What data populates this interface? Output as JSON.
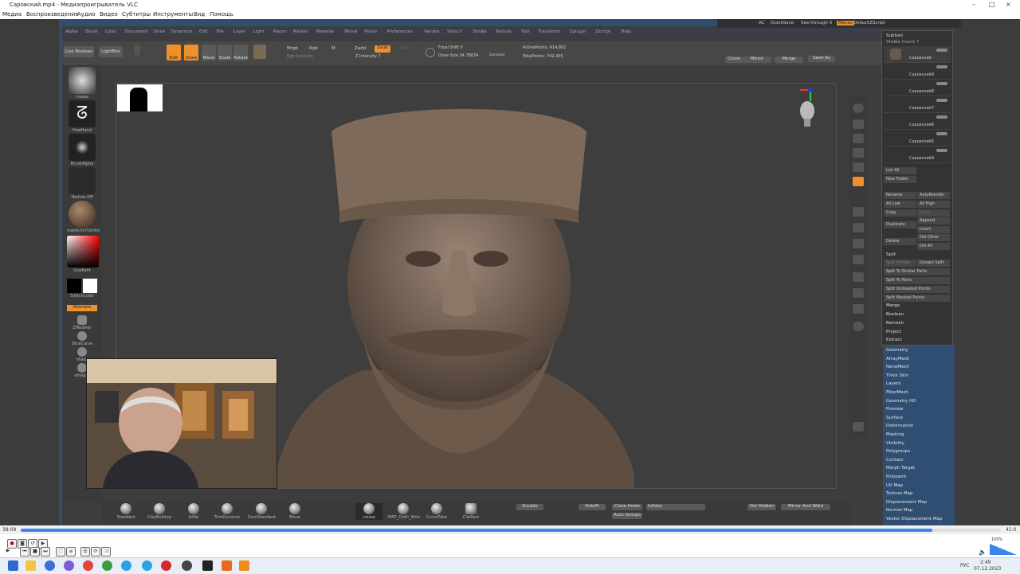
{
  "window": {
    "title": "Саровский.mp4 - Медиапроигрыватель VLC",
    "controls": [
      "–",
      "□",
      "×"
    ]
  },
  "menu": [
    "Медиа",
    "Воспроизведение",
    "Аудио",
    "Видео",
    "Субтитры",
    "Инструменты",
    "Вид",
    "Помощь"
  ],
  "zbrush": {
    "menu": [
      "Alpha",
      "Brush",
      "Color",
      "Document",
      "Draw",
      "Dynamics",
      "Edit",
      "File",
      "Layer",
      "Light",
      "Macro",
      "Marker",
      "Material",
      "Movie",
      "Picker",
      "Preferences",
      "Render",
      "Stencil",
      "Stroke",
      "Texture",
      "Tool",
      "Transform",
      "Zplugin",
      "Zscript",
      "Help"
    ],
    "top_right": [
      "AC",
      "QuickSave",
      "See-through 0",
      "Menus",
      "DefaultZScript"
    ],
    "toolbar": {
      "live_boolean": "Live Boolean",
      "lightbox": "LightBox",
      "edit": "Edit",
      "draw": "Draw",
      "move": "Move",
      "scale": "Scale",
      "rotate": "Rotate",
      "mrgb": "Mrgb",
      "rgb": "Rgb",
      "m": "M",
      "rgb_intensity": "Rgb Intensity",
      "zadd": "Zadd",
      "zsub": "Zsub",
      "zcut": "Zcut",
      "z_intensity": "Z Intensity 7",
      "focal_shift": "Focal Shift 0",
      "draw_size": "Draw Size 34.78834",
      "dynamic": "Dynamic",
      "active_points": "ActivePoints: 414,801",
      "total_points": "TotalPoints: 742,405",
      "clone": "Clone",
      "mirror": "Mirror",
      "merge": "Merge",
      "save_as": "Save As"
    },
    "left_shelf": [
      "crease",
      "FreeHand",
      "BrushAlpha",
      "Texture Off",
      "matAcrimTurntst",
      "Gradient",
      "SwitchColor",
      "Alternate",
      "ZModeler",
      "SliceCurve",
      "sharp",
      "straight"
    ],
    "bottom_shelf": [
      "Standard",
      "ClayBuildup",
      "Inflat",
      "TrimDynamic",
      "DamStandard",
      "Move",
      "crease",
      "XMD_Cloth_Wrin",
      "CurveTube",
      "ClipRect"
    ],
    "bottom_right": {
      "double": "Double",
      "hide_pt": "HidePt",
      "close_holes": "Close Holes",
      "auto_groups": "Auto Groups",
      "inflate": "Inflate",
      "del_hidden": "Del Hidden",
      "mirror_weld": "Mirror And Weld"
    },
    "subtool": {
      "title": "Subtool",
      "visible_count": "Visible Count 7",
      "items": [
        "Саровский",
        "Саровский9",
        "Саровский8",
        "Саровский7",
        "Саровский6",
        "Саровский5",
        "Саровский4"
      ],
      "buttons": [
        "List All",
        "New Folder",
        "Rename",
        "AutoReorder",
        "All Low",
        "All High",
        "Copy",
        "Paste",
        "Duplicate",
        "Append",
        "Insert",
        "Delete",
        "Del Other",
        "Del All"
      ],
      "split": "Split",
      "split_items": [
        "Split Hidden",
        "Groups Split",
        "Split To Similar Parts",
        "Split To Parts",
        "Split Unmasked Points",
        "Split Masked Points"
      ],
      "more": [
        "Merge",
        "Boolean",
        "Remesh",
        "Project",
        "Extract"
      ]
    },
    "tool_palette": [
      "Geometry",
      "ArrayMesh",
      "NanoMesh",
      "Thick Skin",
      "Layers",
      "FiberMesh",
      "Geometry HD",
      "Preview",
      "Surface",
      "Deformation",
      "Masking",
      "Visibility",
      "Polygroups",
      "Contact",
      "Morph Target",
      "Polypaint",
      "UV Map",
      "Texture Map",
      "Displacement Map",
      "Normal Map",
      "Vector Displacement Map"
    ]
  },
  "player": {
    "time_elapsed": "38:09",
    "time_total": "41:0",
    "progress": 0.93,
    "volume": "100%"
  },
  "taskbar": {
    "lang": "РУС",
    "time": "2:49",
    "date": "07.12.2023"
  }
}
